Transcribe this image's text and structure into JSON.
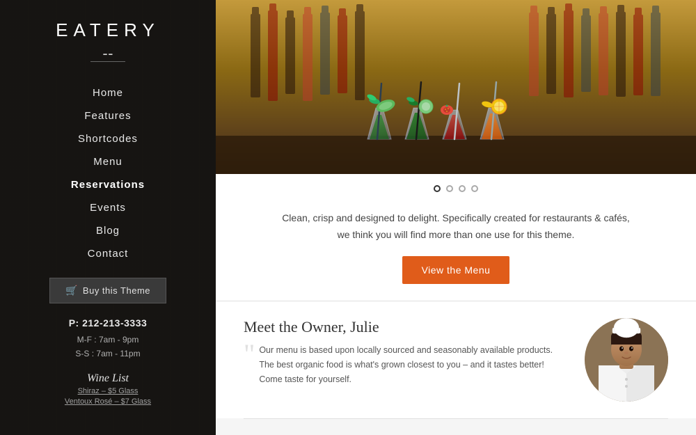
{
  "sidebar": {
    "logo": "EATERY",
    "nav_items": [
      {
        "label": "Home",
        "active": false
      },
      {
        "label": "Features",
        "active": false
      },
      {
        "label": "Shortcodes",
        "active": false
      },
      {
        "label": "Menu",
        "active": false
      },
      {
        "label": "Reservations",
        "active": true
      },
      {
        "label": "Events",
        "active": false
      },
      {
        "label": "Blog",
        "active": false
      },
      {
        "label": "Contact",
        "active": false
      }
    ],
    "buy_button": "Buy this Theme",
    "phone_label": "P: 212-213-3333",
    "hours": [
      "M-F : 7am - 9pm",
      "S-S : 7am - 11pm"
    ],
    "wine_list_title": "Wine List",
    "wine_items": [
      {
        "label": "Shiraz – $5 Glass"
      },
      {
        "label": "Ventoux Rosé – $7 Glass"
      }
    ]
  },
  "main": {
    "carousel_dots": [
      {
        "active": true
      },
      {
        "active": false
      },
      {
        "active": false
      },
      {
        "active": false
      }
    ],
    "tagline": "Clean, crisp and designed to delight. Specifically created for restaurants & cafés, we think you will find more than one use for this theme.",
    "view_menu_label": "View the Menu",
    "owner_section": {
      "title": "Meet the Owner, Julie",
      "quote": "Our menu is based upon locally sourced and seasonably available products. The best organic food is what's grown closest to you – and it tastes better! Come taste for yourself."
    }
  },
  "colors": {
    "accent": "#e05c1a",
    "sidebar_bg": "#1e1c1c",
    "nav_active": "#ffffff"
  }
}
